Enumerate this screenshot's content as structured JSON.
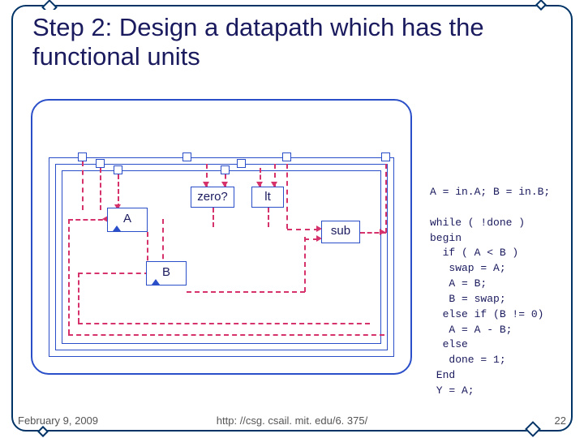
{
  "title": "Step 2:  Design a datapath which has the functional units",
  "units": {
    "zero": "zero?",
    "lt": "lt",
    "sub": "sub"
  },
  "registers": {
    "a": "A",
    "b": "B"
  },
  "code": "A = in.A; B = in.B;\n\nwhile ( !done )\nbegin\n  if ( A < B )\n   swap = A;\n   A = B;\n   B = swap;\n  else if (B != 0)\n   A = A - B;\n  else\n   done = 1;\n End\n Y = A;",
  "footer": {
    "date": "February 9, 2009",
    "url": "http: //csg. csail. mit. edu/6. 375/",
    "page": "22"
  }
}
